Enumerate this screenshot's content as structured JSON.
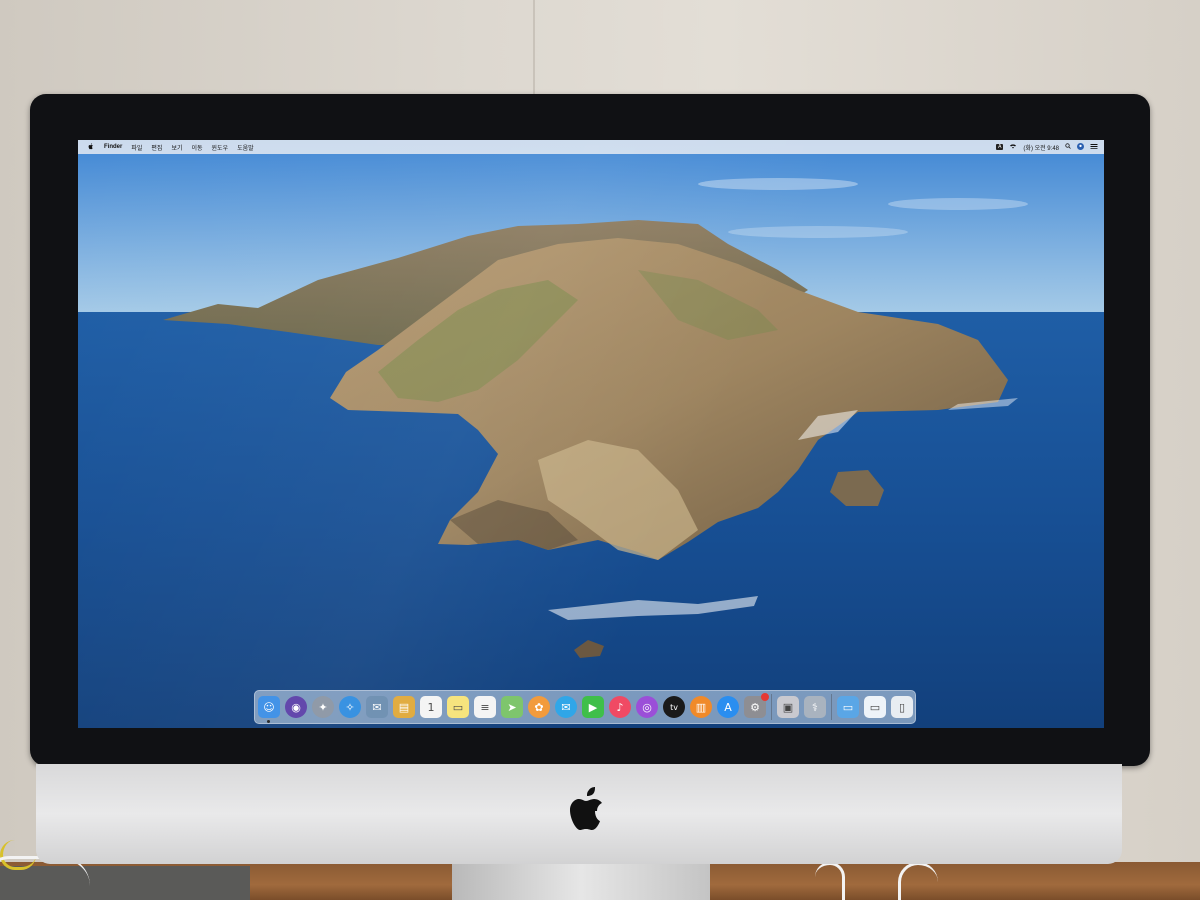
{
  "menubar": {
    "apple_icon": "apple-icon",
    "items": [
      {
        "label": "Finder",
        "app": true
      },
      {
        "label": "파일"
      },
      {
        "label": "편집"
      },
      {
        "label": "보기"
      },
      {
        "label": "이동"
      },
      {
        "label": "윈도우"
      },
      {
        "label": "도움말"
      }
    ],
    "status": {
      "input_source": "A",
      "wifi_icon": "wifi-icon",
      "clock": "(화) 오전 9:48",
      "search_icon": "spotlight-search-icon",
      "user_icon": "user-icon",
      "control_icon": "notification-center-icon"
    }
  },
  "dock": {
    "apps": [
      {
        "name": "finder",
        "icon": "finder-icon",
        "color": "#3a8ee6",
        "glyph": "☺",
        "running": true
      },
      {
        "name": "siri",
        "icon": "siri-icon",
        "color": "#5b3fa8",
        "glyph": "◉",
        "round": true
      },
      {
        "name": "launchpad",
        "icon": "launchpad-icon",
        "color": "#8a95a3",
        "glyph": "✦",
        "round": true
      },
      {
        "name": "safari",
        "icon": "safari-icon",
        "color": "#2f8de0",
        "glyph": "✧",
        "round": true
      },
      {
        "name": "mail",
        "icon": "mail-icon",
        "color": "#6b8db0",
        "glyph": "✉"
      },
      {
        "name": "notes",
        "icon": "notes-icon",
        "color": "#e0a93a",
        "glyph": "▤"
      },
      {
        "name": "calendar",
        "icon": "calendar-icon",
        "color": "#f4f4f4",
        "glyph": "1"
      },
      {
        "name": "stickies",
        "icon": "stickies-icon",
        "color": "#f6e37a",
        "glyph": "▭"
      },
      {
        "name": "reminders",
        "icon": "reminders-icon",
        "color": "#f4f4f4",
        "glyph": "≡"
      },
      {
        "name": "maps",
        "icon": "maps-icon",
        "color": "#7cc46a",
        "glyph": "➤"
      },
      {
        "name": "photos",
        "icon": "photos-icon",
        "color": "#f29a3a",
        "glyph": "✿",
        "round": true
      },
      {
        "name": "messages",
        "icon": "messages-icon",
        "color": "#2fa6e8",
        "glyph": "✉",
        "round": true
      },
      {
        "name": "facetime",
        "icon": "facetime-icon",
        "color": "#3fbf4a",
        "glyph": "▶"
      },
      {
        "name": "music",
        "icon": "music-icon",
        "color": "#f04a64",
        "glyph": "♪",
        "round": true
      },
      {
        "name": "podcasts",
        "icon": "podcasts-icon",
        "color": "#9b4fd8",
        "glyph": "◎",
        "round": true
      },
      {
        "name": "apple-tv",
        "icon": "apple-tv-icon",
        "color": "#1a1a1a",
        "glyph": "tv",
        "round": true
      },
      {
        "name": "books",
        "icon": "books-icon",
        "color": "#f08a2a",
        "glyph": "▥",
        "round": true
      },
      {
        "name": "app-store",
        "icon": "app-store-icon",
        "color": "#2a8ef0",
        "glyph": "A",
        "round": true
      },
      {
        "name": "system-preferences",
        "icon": "system-preferences-icon",
        "color": "#8e8e93",
        "glyph": "⚙",
        "badge": true
      }
    ],
    "utilities": [
      {
        "name": "preview",
        "icon": "preview-icon",
        "color": "#c9c9cf",
        "glyph": "▣"
      },
      {
        "name": "disk-utility",
        "icon": "disk-utility-icon",
        "color": "#a9b3bf",
        "glyph": "⚕"
      }
    ],
    "stacks": [
      {
        "name": "downloads-folder",
        "icon": "folder-icon",
        "color": "#5aa6e6",
        "glyph": "▭"
      },
      {
        "name": "documents-stack",
        "icon": "document-stack-icon",
        "color": "#eef3f8",
        "glyph": "▭"
      },
      {
        "name": "trash",
        "icon": "trash-icon",
        "color": "#e8edf2",
        "glyph": "▯"
      }
    ]
  }
}
